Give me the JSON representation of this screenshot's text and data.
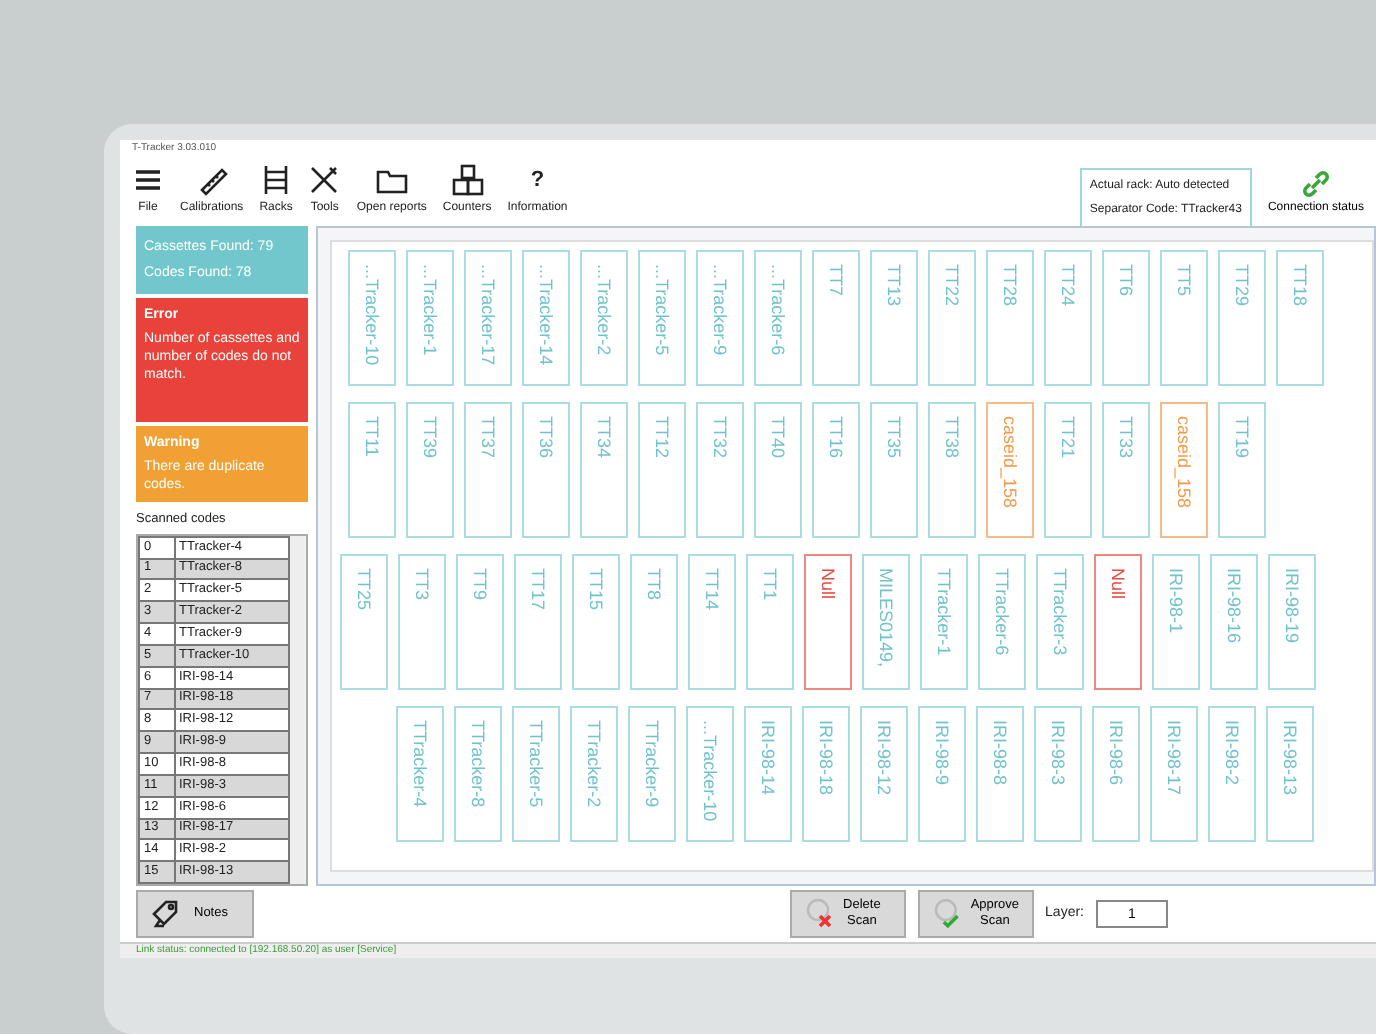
{
  "window": {
    "title": "T-Tracker 3.03.010"
  },
  "toolbar": [
    {
      "kind": "menu",
      "label": "File"
    },
    {
      "kind": "ruler",
      "label": "Calibrations"
    },
    {
      "kind": "rack",
      "label": "Racks"
    },
    {
      "kind": "tools",
      "label": "Tools"
    },
    {
      "kind": "folder",
      "label": "Open reports"
    },
    {
      "kind": "counters",
      "label": "Counters"
    },
    {
      "kind": "help",
      "label": "Information",
      "glyph": "?"
    }
  ],
  "rack_info": [
    "Actual rack: Auto detected",
    "Separator Code: TTracker43"
  ],
  "connection": {
    "label": "Connection status"
  },
  "summary": [
    "Cassettes Found:  79",
    "Codes Found:  78"
  ],
  "alerts": [
    {
      "kind": "error",
      "title": "Error",
      "text": "Number of cassettes and number of codes do not match."
    },
    {
      "kind": "warning",
      "title": "Warning",
      "text": "There are duplicate codes."
    }
  ],
  "scanned": {
    "title": "Scanned codes",
    "rows": [
      [
        "0",
        "TTracker-4"
      ],
      [
        "1",
        "TTracker-8"
      ],
      [
        "2",
        "TTracker-5"
      ],
      [
        "3",
        "TTracker-2"
      ],
      [
        "4",
        "TTracker-9"
      ],
      [
        "5",
        "TTracker-10"
      ],
      [
        "6",
        "IRI-98-14"
      ],
      [
        "7",
        "IRI-98-18"
      ],
      [
        "8",
        "IRI-98-12"
      ],
      [
        "9",
        "IRI-98-9"
      ],
      [
        "10",
        "IRI-98-8"
      ],
      [
        "11",
        "IRI-98-3"
      ],
      [
        "12",
        "IRI-98-6"
      ],
      [
        "13",
        "IRI-98-17"
      ],
      [
        "14",
        "IRI-98-2"
      ],
      [
        "15",
        "IRI-98-13"
      ]
    ]
  },
  "rack_rows": [
    [
      {
        "label": "...Tracker-10",
        "kind": "ok"
      },
      {
        "label": "...Tracker-1",
        "kind": "ok"
      },
      {
        "label": "...Tracker-17",
        "kind": "ok"
      },
      {
        "label": "...Tracker-14",
        "kind": "ok"
      },
      {
        "label": "...Tracker-2",
        "kind": "ok"
      },
      {
        "label": "...Tracker-5",
        "kind": "ok"
      },
      {
        "label": "...Tracker-9",
        "kind": "ok"
      },
      {
        "label": "...Tracker-6",
        "kind": "ok"
      },
      {
        "label": "TT7",
        "kind": "ok"
      },
      {
        "label": "TT13",
        "kind": "ok"
      },
      {
        "label": "TT22",
        "kind": "ok"
      },
      {
        "label": "TT28",
        "kind": "ok"
      },
      {
        "label": "TT24",
        "kind": "ok"
      },
      {
        "label": "TT6",
        "kind": "ok"
      },
      {
        "label": "TT5",
        "kind": "ok"
      },
      {
        "label": "TT29",
        "kind": "ok"
      },
      {
        "label": "TT18",
        "kind": "ok"
      }
    ],
    [
      {
        "label": "TT11",
        "kind": "ok"
      },
      {
        "label": "TT39",
        "kind": "ok"
      },
      {
        "label": "TT37",
        "kind": "ok"
      },
      {
        "label": "TT36",
        "kind": "ok"
      },
      {
        "label": "TT34",
        "kind": "ok"
      },
      {
        "label": "TT12",
        "kind": "ok"
      },
      {
        "label": "TT32",
        "kind": "ok"
      },
      {
        "label": "TT40",
        "kind": "ok"
      },
      {
        "label": "TT16",
        "kind": "ok"
      },
      {
        "label": "TT35",
        "kind": "ok"
      },
      {
        "label": "TT38",
        "kind": "ok"
      },
      {
        "label": "caseid_158",
        "kind": "duplicate"
      },
      {
        "label": "TT21",
        "kind": "ok"
      },
      {
        "label": "TT33",
        "kind": "ok"
      },
      {
        "label": "caseid_158",
        "kind": "duplicate"
      },
      {
        "label": "TT19",
        "kind": "ok"
      }
    ],
    [
      {
        "label": "TT25",
        "kind": "ok"
      },
      {
        "label": "TT3",
        "kind": "ok"
      },
      {
        "label": "TT9",
        "kind": "ok"
      },
      {
        "label": "TT17",
        "kind": "ok"
      },
      {
        "label": "TT15",
        "kind": "ok"
      },
      {
        "label": "TT8",
        "kind": "ok"
      },
      {
        "label": "TT14",
        "kind": "ok"
      },
      {
        "label": "TT1",
        "kind": "ok"
      },
      {
        "label": "Null",
        "kind": "null"
      },
      {
        "label": "MILES0149,",
        "kind": "ok"
      },
      {
        "label": "TTracker-1",
        "kind": "ok"
      },
      {
        "label": "TTracker-6",
        "kind": "ok"
      },
      {
        "label": "TTracker-3",
        "kind": "ok"
      },
      {
        "label": "Null",
        "kind": "null"
      },
      {
        "label": "IRI-98-1",
        "kind": "ok"
      },
      {
        "label": "IRI-98-16",
        "kind": "ok"
      },
      {
        "label": "IRI-98-19",
        "kind": "ok"
      }
    ],
    [
      {
        "label": "TTracker-4",
        "kind": "ok"
      },
      {
        "label": "TTracker-8",
        "kind": "ok"
      },
      {
        "label": "TTracker-5",
        "kind": "ok"
      },
      {
        "label": "TTracker-2",
        "kind": "ok"
      },
      {
        "label": "TTracker-9",
        "kind": "ok"
      },
      {
        "label": "...Tracker-10",
        "kind": "ok"
      },
      {
        "label": "IRI-98-14",
        "kind": "ok"
      },
      {
        "label": "IRI-98-18",
        "kind": "ok"
      },
      {
        "label": "IRI-98-12",
        "kind": "ok"
      },
      {
        "label": "IRI-98-9",
        "kind": "ok"
      },
      {
        "label": "IRI-98-8",
        "kind": "ok"
      },
      {
        "label": "IRI-98-3",
        "kind": "ok"
      },
      {
        "label": "IRI-98-6",
        "kind": "ok"
      },
      {
        "label": "IRI-98-17",
        "kind": "ok"
      },
      {
        "label": "IRI-98-2",
        "kind": "ok"
      },
      {
        "label": "IRI-98-13",
        "kind": "ok"
      }
    ]
  ],
  "footer": {
    "notes": "Notes",
    "delete": [
      "Delete",
      "Scan"
    ],
    "approve": [
      "Approve",
      "Scan"
    ],
    "layer_label": "Layer:",
    "layer_value": "1"
  },
  "status_bar": "Link status: connected to [192.168.50.20] as user [Service]"
}
